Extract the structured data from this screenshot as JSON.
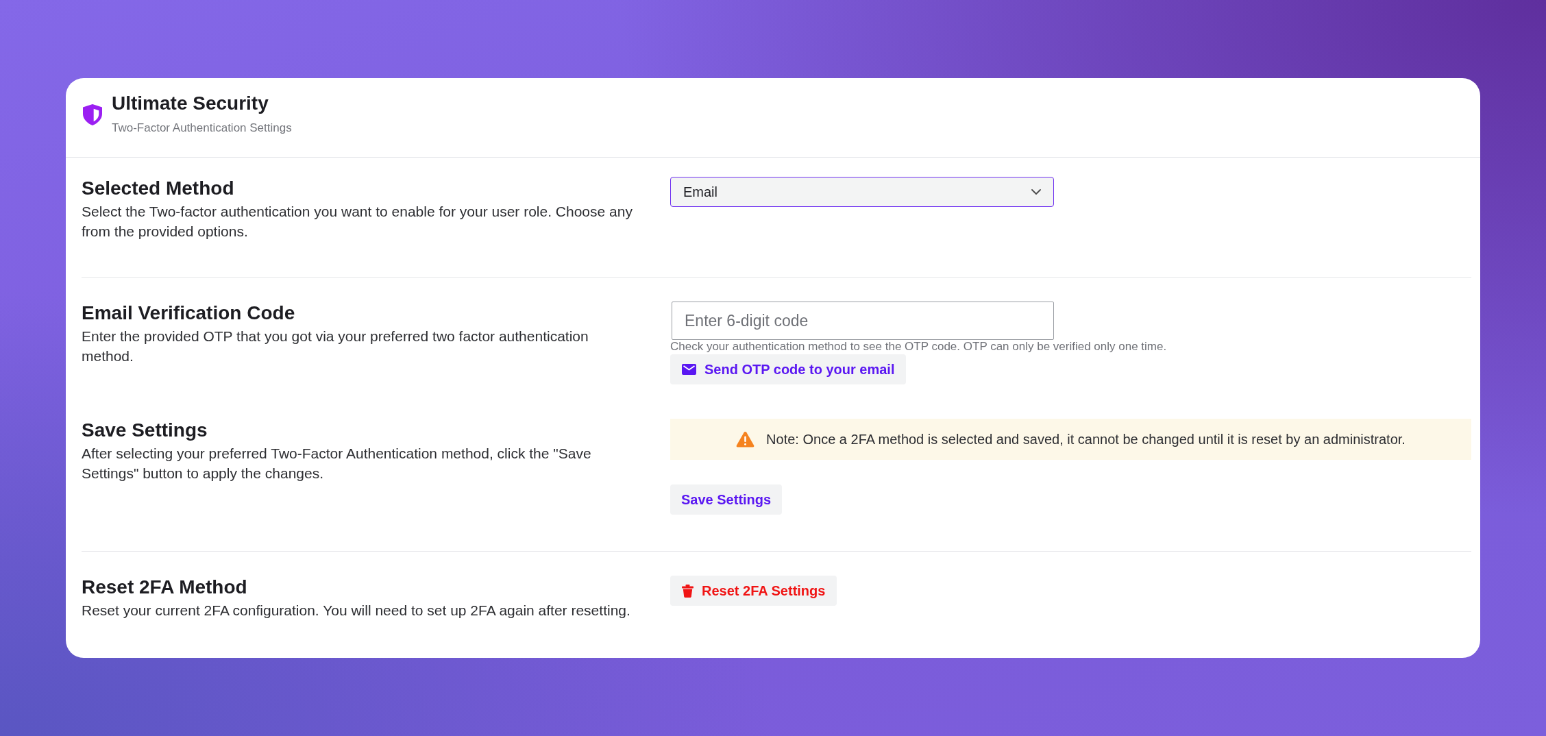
{
  "header": {
    "title": "Ultimate Security",
    "subtitle": "Two-Factor Authentication Settings"
  },
  "groups": [
    {
      "sections": [
        {
          "title": "Selected Method",
          "description": "Select the Two-factor authentication you want to enable for your user role. Choose any from the provided options.",
          "controls": [
            {
              "kind": "select",
              "value": "Email",
              "focused": true
            }
          ]
        }
      ]
    },
    {
      "sections": [
        {
          "title": "Email Verification Code",
          "description": "Enter the provided OTP that you got via your preferred two factor authentication method.",
          "controls": [
            {
              "kind": "input",
              "placeholder": "Enter 6-digit code"
            },
            {
              "kind": "hint",
              "text": "Check your authentication method to see the OTP code. OTP can only be verified only one time."
            },
            {
              "kind": "send",
              "label": "Send OTP code to your email"
            }
          ]
        },
        {
          "title": "Save Settings",
          "description": "After selecting your preferred Two-Factor Authentication method, click the \"Save Settings\" button to apply the changes.",
          "controls": [
            {
              "kind": "note",
              "text": "Note: Once a 2FA method is selected and saved, it cannot be changed until it is reset by an administrator."
            },
            {
              "kind": "save",
              "label": "Save Settings"
            }
          ]
        }
      ]
    },
    {
      "sections": [
        {
          "title": "Reset 2FA Method",
          "description": "Reset your current 2FA configuration. You will need to set up 2FA again after resetting.",
          "controls": [
            {
              "kind": "reset",
              "label": "Reset 2FA Settings"
            }
          ]
        }
      ]
    }
  ]
}
